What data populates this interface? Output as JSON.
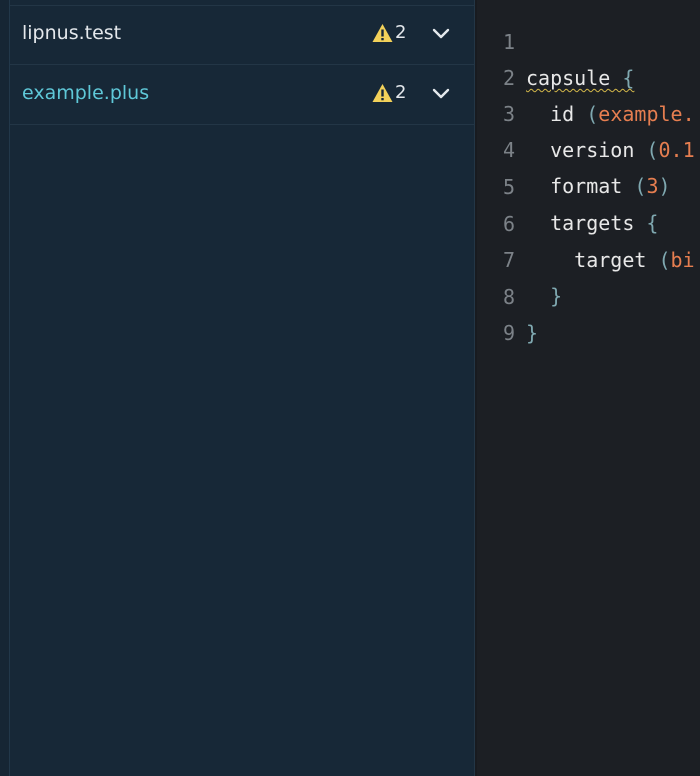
{
  "sidebar": {
    "items": [
      {
        "label": "lipnus.test",
        "warning_count": "2",
        "active": false
      },
      {
        "label": "example.plus",
        "warning_count": "2",
        "active": true
      }
    ]
  },
  "editor": {
    "lines": [
      {
        "num": "1",
        "kw": "capsule",
        "rest": " {"
      },
      {
        "num": "2",
        "indent": "  ",
        "kw": "id",
        "open": " (",
        "val": "example."
      },
      {
        "num": "3",
        "indent": "  ",
        "kw": "version",
        "open": " (",
        "val": "0.1"
      },
      {
        "num": "4",
        "indent": "  ",
        "kw": "format",
        "open": " (",
        "val": "3",
        "close": ")"
      },
      {
        "num": "5",
        "indent": "  ",
        "kw": "targets",
        "brace": " {"
      },
      {
        "num": "6",
        "indent": "    ",
        "kw": "target",
        "open": " (",
        "val": "bi"
      },
      {
        "num": "7",
        "indent": "  ",
        "brace": "}"
      },
      {
        "num": "8",
        "brace": "}"
      },
      {
        "num": "9"
      }
    ]
  },
  "colors": {
    "sidebar_bg": "#172837",
    "active_label": "#5fc8d8",
    "warning_icon": "#f2d15a",
    "editor_bg": "#1c1f24",
    "code_value": "#e67e50"
  },
  "icons": {
    "warning": "warning-icon",
    "expand": "chevron-down-icon"
  }
}
